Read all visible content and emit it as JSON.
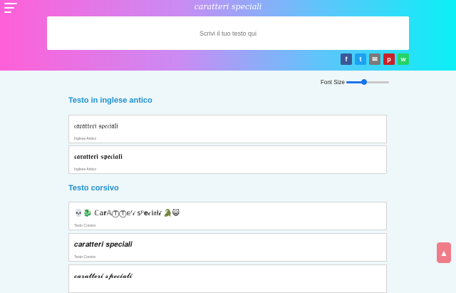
{
  "header": {
    "title": "caratteri speciali",
    "input_placeholder": "Scrivi il tuo testo qui"
  },
  "share": [
    "f",
    "t",
    "✉",
    "p",
    "w"
  ],
  "font_size": {
    "label": "Font Size",
    "value_fraction": 0.42
  },
  "sections": [
    {
      "title": "Testo in inglese antico",
      "cards": [
        {
          "text": "𝔠𝔞𝔯𝔞𝔱𝔱𝔢𝔯𝔦 𝔰𝔭𝔢𝔠𝔦𝔞𝔩𝔦",
          "sub": "Inglese Antico"
        },
        {
          "text": "𝖈𝖆𝖗𝖆𝖙𝖙𝖊𝖗𝖎 𝖘𝖕𝖊𝖈𝖎𝖆𝖑𝖎",
          "sub": "Inglese Antico"
        }
      ]
    },
    {
      "title": "Testo corsivo",
      "cards": [
        {
          "text": "💀🐉 ℂ𝕒𝐫𝔸ⓉⓉ𝕖ʳ𝒾 ѕᵖ𝐞𝒸𝕚𝔞ł𝓲 🐊😺",
          "sub": "Testo Corsivo"
        },
        {
          "text": "𝒄𝒂𝒓𝒂𝒕𝒕𝒆𝒓𝒊 𝒔𝒑𝒆𝒄𝒊𝒂𝒍𝒊",
          "sub": "Testo Corsivo"
        },
        {
          "text": "𝓬𝓪𝓻𝓪𝓽𝓽𝓮𝓻𝓲 𝓼𝓹𝓮𝓬𝓲𝓪𝓵𝓲",
          "sub": ""
        }
      ]
    }
  ],
  "back_to_top": "▲"
}
